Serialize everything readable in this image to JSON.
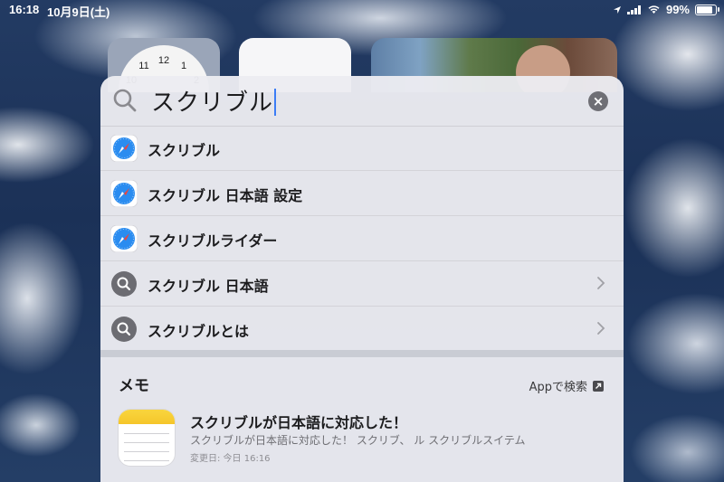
{
  "status_bar": {
    "time": "16:18",
    "date": "10月9日(土)",
    "battery": "99%",
    "battery_level": 0.99,
    "icons": [
      "location-arrow-icon",
      "cellular-signal-icon",
      "wifi-icon",
      "battery-icon"
    ]
  },
  "search": {
    "query": "スクリブル"
  },
  "results": [
    {
      "label": "スクリブル",
      "icon": "safari-icon",
      "has_chevron": false
    },
    {
      "label": "スクリブル 日本語 設定",
      "icon": "safari-icon",
      "has_chevron": false
    },
    {
      "label": "スクリブルライダー",
      "icon": "safari-icon",
      "has_chevron": false
    },
    {
      "label": "スクリブル 日本語",
      "icon": "search-icon",
      "has_chevron": true
    },
    {
      "label": "スクリブルとは",
      "icon": "search-icon",
      "has_chevron": true
    }
  ],
  "notes_section": {
    "title": "メモ",
    "app_search_label": "Appで検索",
    "note": {
      "title": "スクリブルが日本語に対応した！",
      "snippet": "スクリブルが日本語に対応した！ スクリブ、 ル スクリブルスイテム",
      "date": "変更日: 今日 16:16",
      "icon": "notes-app-icon"
    }
  },
  "colors": {
    "accent": "#3c7df6",
    "notes_yellow": "#f5c62a"
  }
}
